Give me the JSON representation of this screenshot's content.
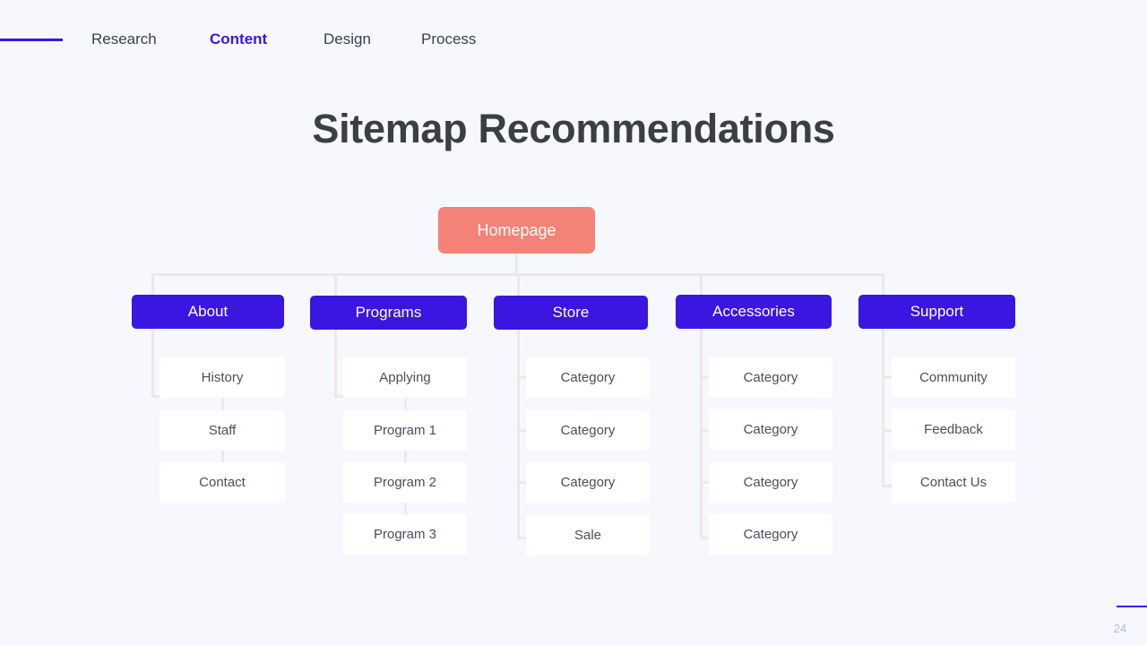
{
  "nav": {
    "rule": "accent-rule",
    "items": [
      {
        "label": "Research",
        "active": false
      },
      {
        "label": "Content",
        "active": true
      },
      {
        "label": "Design",
        "active": false
      },
      {
        "label": "Process",
        "active": false
      }
    ]
  },
  "title": "Sitemap Recommendations",
  "sitemap": {
    "root": {
      "label": "Homepage"
    },
    "sections": [
      {
        "label": "About",
        "children": [
          {
            "label": "History"
          },
          {
            "label": "Staff"
          },
          {
            "label": "Contact"
          }
        ]
      },
      {
        "label": "Programs",
        "children": [
          {
            "label": "Applying"
          },
          {
            "label": "Program 1"
          },
          {
            "label": "Program 2"
          },
          {
            "label": "Program 3"
          }
        ]
      },
      {
        "label": "Store",
        "children": [
          {
            "label": "Category"
          },
          {
            "label": "Category"
          },
          {
            "label": "Category"
          },
          {
            "label": "Sale"
          }
        ]
      },
      {
        "label": "Accessories",
        "children": [
          {
            "label": "Category"
          },
          {
            "label": "Category"
          },
          {
            "label": "Category"
          },
          {
            "label": "Category"
          }
        ]
      },
      {
        "label": "Support",
        "children": [
          {
            "label": "Community"
          },
          {
            "label": "Feedback"
          },
          {
            "label": "Contact Us"
          }
        ]
      }
    ]
  },
  "footer": {
    "page_number": "24"
  },
  "colors": {
    "background": "#f6f8fd",
    "accent_blue": "#3a16e0",
    "root_salmon": "#f58276",
    "connector": "#ece9e6",
    "leaf_bg": "#ffffff",
    "title_text": "#3b3f42"
  }
}
